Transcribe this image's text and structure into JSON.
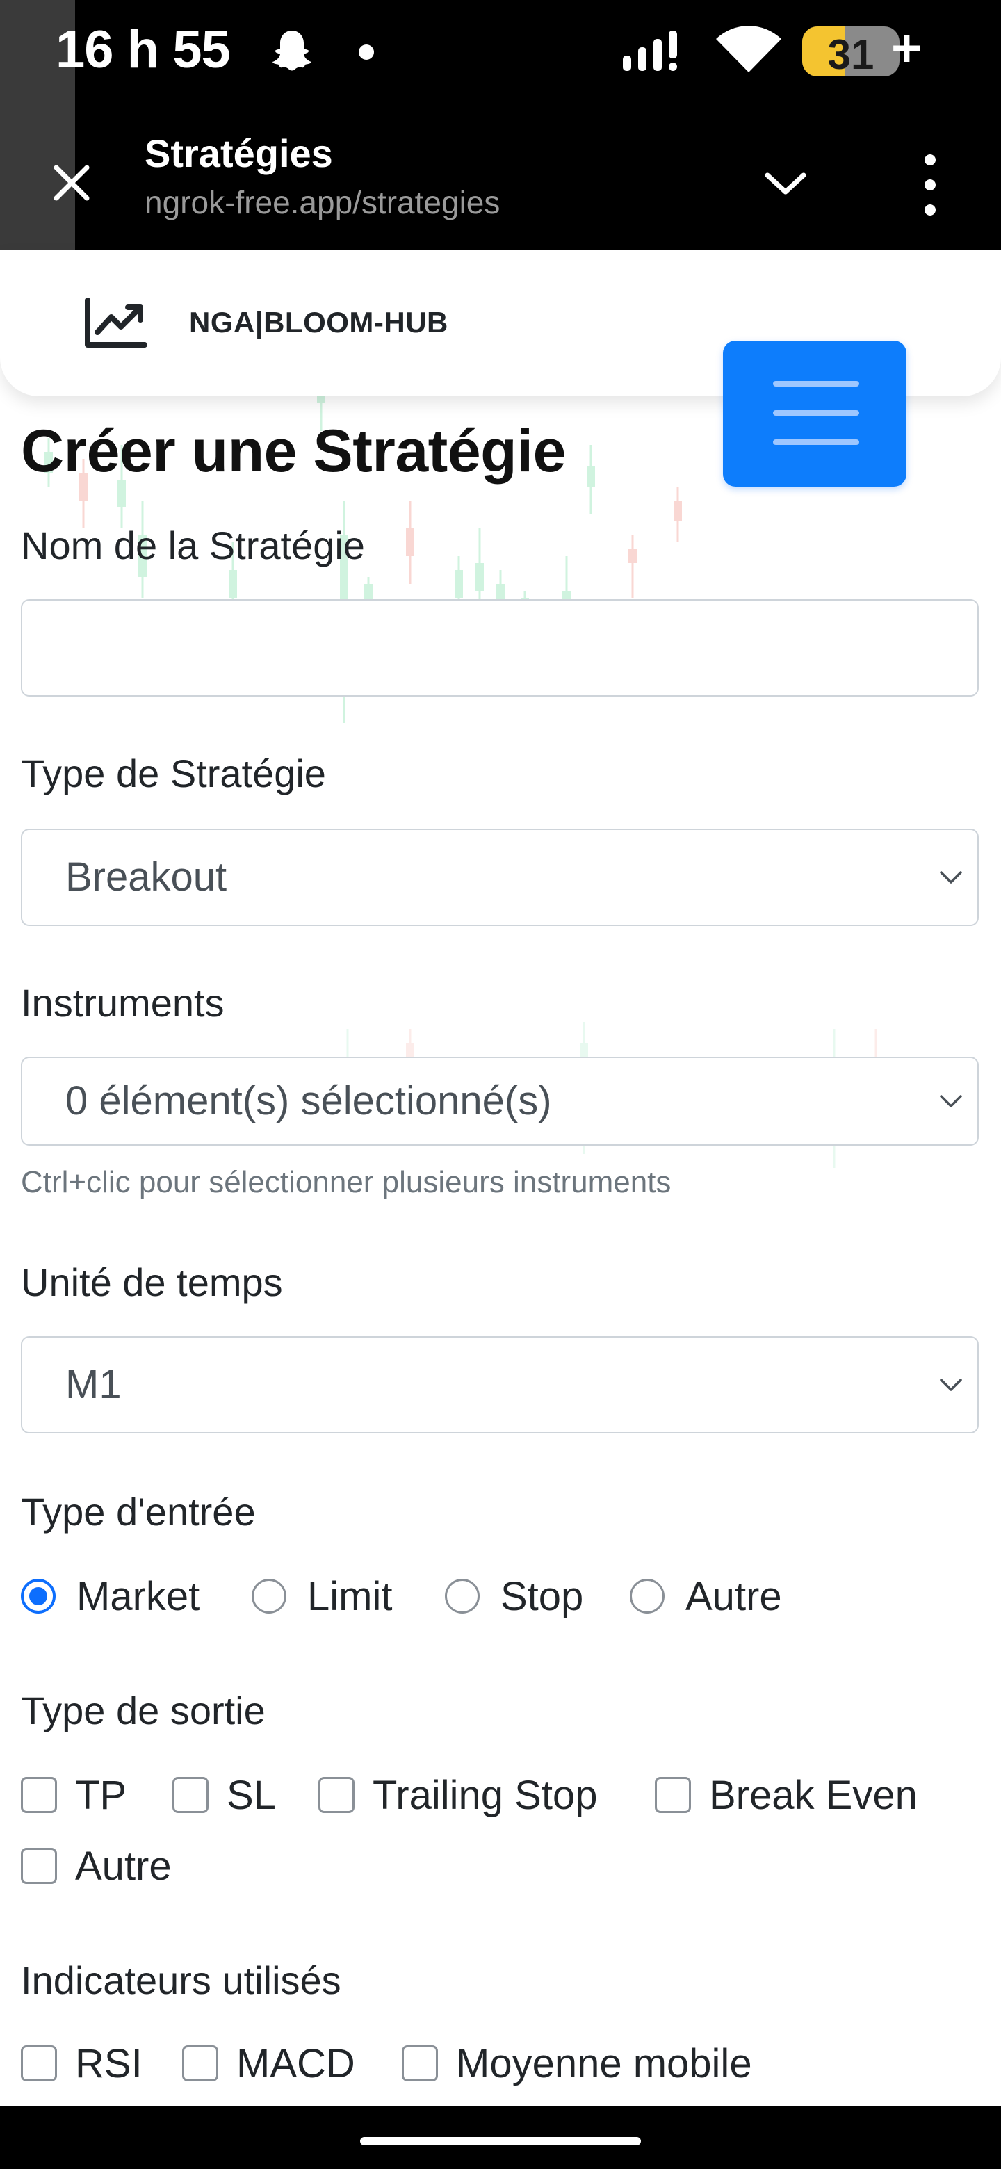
{
  "status_bar": {
    "time": "16 h 55",
    "battery": "31",
    "battery_plus": "+",
    "icons": [
      "snapchat-ghost-icon",
      "notification-dot-icon",
      "signal-icon",
      "wifi-icon",
      "battery-icon"
    ]
  },
  "browser": {
    "page_title": "Stratégies",
    "url": "ngrok-free.app/strategies",
    "icons": [
      "close-icon",
      "chevron-down-icon",
      "more-vertical-icon"
    ]
  },
  "navbar": {
    "brand": "NGA|BLOOM-HUB",
    "logo_icon": "trending-chart-icon",
    "toggle_icon": "hamburger-menu-icon",
    "accent_color": "#0d7dfc"
  },
  "form": {
    "title": "Créer une Stratégie",
    "name_label": "Nom de la Stratégie",
    "name_value": "",
    "type_label": "Type de Stratégie",
    "type_value": "Breakout",
    "instruments_label": "Instruments",
    "instruments_value": "0 élément(s) sélectionné(s)",
    "instruments_help": "Ctrl+clic pour sélectionner plusieurs instruments",
    "timeframe_label": "Unité de temps",
    "timeframe_value": "M1",
    "entry_label": "Type d'entrée",
    "entry_options": [
      "Market",
      "Limit",
      "Stop",
      "Autre"
    ],
    "entry_selected": "Market",
    "exit_label": "Type de sortie",
    "exit_options": [
      "TP",
      "SL",
      "Trailing Stop",
      "Break Even",
      "Autre"
    ],
    "indicators_label": "Indicateurs utilisés",
    "indicator_options": [
      "RSI",
      "MACD",
      "Moyenne mobile"
    ]
  }
}
